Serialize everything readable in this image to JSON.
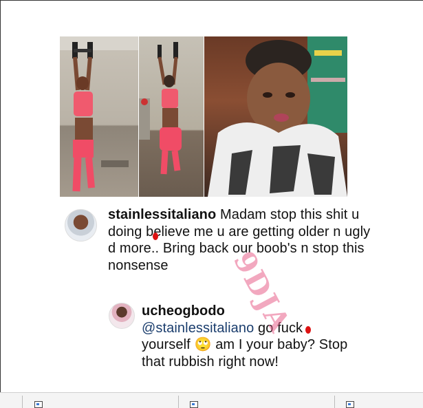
{
  "comments": [
    {
      "username": "stainlessitaliano",
      "text": "Madam stop this shit u doing believe me u are getting older n ugly d more.. Bring back our boob's n stop this nonsense"
    },
    {
      "username": "ucheogbodo",
      "mention": "@stainlessitaliano",
      "text": "go fuck yourself",
      "emoji": "🙄",
      "text_after": "am I your baby? Stop that rubbish right now!"
    }
  ],
  "watermark": "9DJA",
  "toolbar": {
    "icons": [
      "image-icon",
      "image-icon",
      "image-icon"
    ]
  }
}
